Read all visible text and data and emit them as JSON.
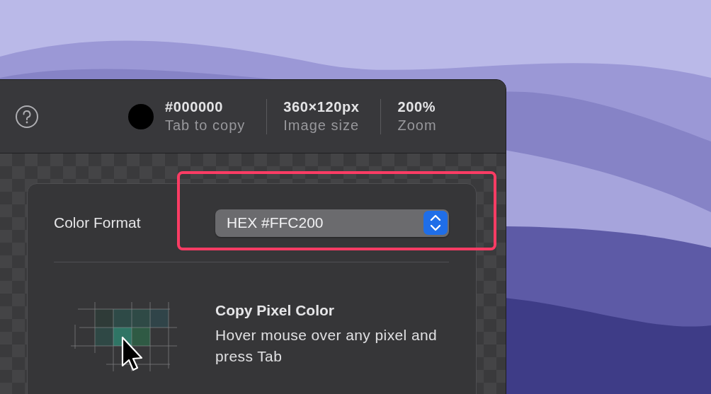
{
  "toolbar": {
    "stats": [
      {
        "value": "#000000",
        "label": "Tab to copy",
        "kind": "color"
      },
      {
        "value": "360×120px",
        "label": "Image size",
        "kind": "text"
      },
      {
        "value": "200%",
        "label": "Zoom",
        "kind": "text"
      }
    ]
  },
  "settings": {
    "label": "Color Format",
    "value": "HEX #FFC200"
  },
  "feature": {
    "title": "Copy Pixel Color",
    "description": "Hover mouse over any pixel and press Tab"
  }
}
